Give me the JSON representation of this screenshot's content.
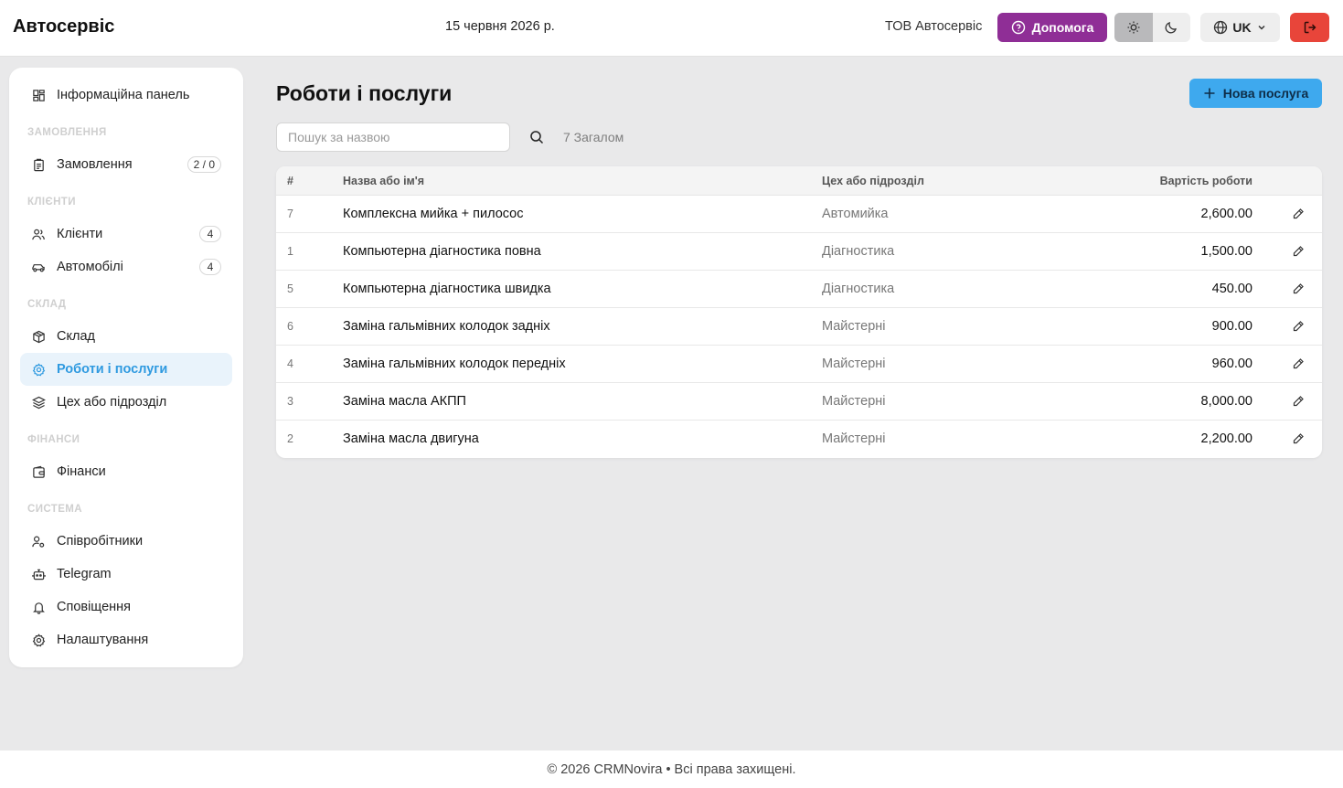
{
  "header": {
    "brand": "Автосервіс",
    "date": "15 червня 2026 р.",
    "company": "ТОВ Автосервіс",
    "help_label": "Допомога",
    "language": "UK",
    "help_color": "#8f2e96",
    "logout_color": "#e8453a"
  },
  "sidebar": {
    "dashboard": "Інформаційна панель",
    "sections": {
      "orders": "ЗАМОВЛЕННЯ",
      "clients": "КЛІЄНТИ",
      "warehouse": "СКЛАД",
      "finance": "ФІНАНСИ",
      "system": "СИСТЕМА"
    },
    "items": {
      "orders": {
        "label": "Замовлення",
        "badge": "2 / 0"
      },
      "clients": {
        "label": "Клієнти",
        "badge": "4"
      },
      "cars": {
        "label": "Автомобілі",
        "badge": "4"
      },
      "warehouse": {
        "label": "Склад"
      },
      "services": {
        "label": "Роботи і послуги"
      },
      "departments": {
        "label": "Цех або підрозділ"
      },
      "finance": {
        "label": "Фінанси"
      },
      "employees": {
        "label": "Співробітники"
      },
      "telegram": {
        "label": "Telegram"
      },
      "notifications": {
        "label": "Сповіщення"
      },
      "settings": {
        "label": "Налаштування"
      }
    }
  },
  "main": {
    "title": "Роботи і послуги",
    "new_button": "Нова послуга",
    "search_placeholder": "Пошук за назвою",
    "total": "7 Загалом",
    "columns": {
      "id": "#",
      "name": "Назва або ім'я",
      "department": "Цех або підрозділ",
      "price": "Вартість роботи"
    },
    "rows": [
      {
        "id": "7",
        "name": "Комплексна мийка + пилосос",
        "department": "Автомийка",
        "price": "2,600.00"
      },
      {
        "id": "1",
        "name": "Компьютерна діагностика повна",
        "department": "Діагностика",
        "price": "1,500.00"
      },
      {
        "id": "5",
        "name": "Компьютерна діагностика швидка",
        "department": "Діагностика",
        "price": "450.00"
      },
      {
        "id": "6",
        "name": "Заміна гальмівних колодок задніх",
        "department": "Майстерні",
        "price": "900.00"
      },
      {
        "id": "4",
        "name": "Заміна гальмівних колодок передніх",
        "department": "Майстерні",
        "price": "960.00"
      },
      {
        "id": "3",
        "name": "Заміна масла АКПП",
        "department": "Майстерні",
        "price": "8,000.00"
      },
      {
        "id": "2",
        "name": "Заміна масла двигуна",
        "department": "Майстерні",
        "price": "2,200.00"
      }
    ]
  },
  "footer": {
    "text": "© 2026 CRMNovira • Всі права захищені."
  }
}
